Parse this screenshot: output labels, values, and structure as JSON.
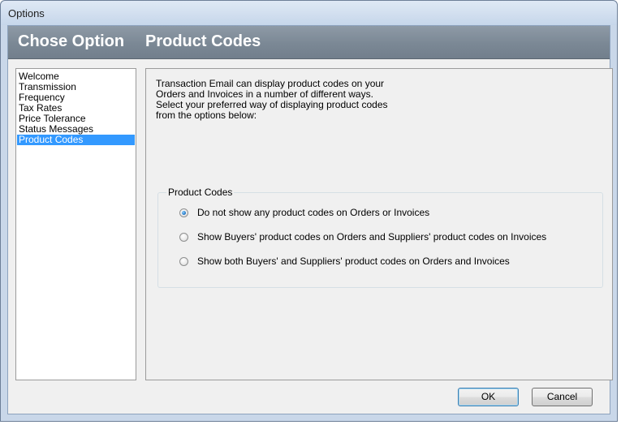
{
  "window": {
    "title": "Options"
  },
  "header": {
    "left": "Chose Option",
    "right": "Product Codes"
  },
  "nav": {
    "items": [
      {
        "label": "Welcome"
      },
      {
        "label": "Transmission"
      },
      {
        "label": "Frequency"
      },
      {
        "label": "Tax Rates"
      },
      {
        "label": "Price Tolerance"
      },
      {
        "label": "Status Messages"
      },
      {
        "label": "Product Codes"
      }
    ],
    "selected": "Product Codes"
  },
  "content": {
    "description": [
      "Transaction Email can display product codes on your",
      "Orders and Invoices in a number of different ways.",
      "Select your preferred way of displaying product codes",
      "from the options below:"
    ],
    "group_label": "Product Codes",
    "options": [
      {
        "label": "Do not show any product codes on Orders or Invoices",
        "checked": true
      },
      {
        "label": "Show Buyers' product codes on Orders and Suppliers' product codes on Invoices",
        "checked": false
      },
      {
        "label": "Show both Buyers' and Suppliers' product codes on Orders and Invoices",
        "checked": false
      }
    ]
  },
  "buttons": {
    "ok": "OK",
    "cancel": "Cancel"
  }
}
